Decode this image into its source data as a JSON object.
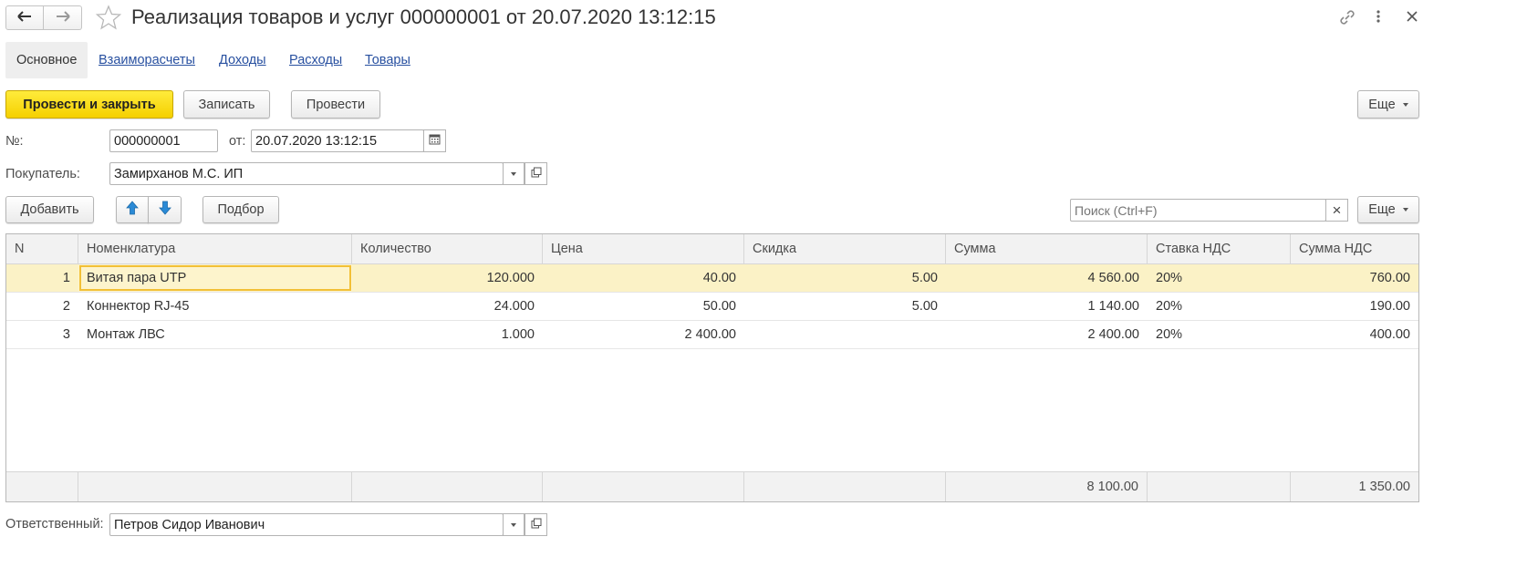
{
  "window": {
    "title": "Реализация товаров и услуг 000000001 от 20.07.2020 13:12:15",
    "back_glyph": "🡐",
    "forward_glyph": "🡒",
    "star_glyph": "☆",
    "link_glyph": "🔗",
    "more_glyph": "⋮",
    "close_glyph": "×"
  },
  "tabs": [
    {
      "label": "Основное",
      "active": true
    },
    {
      "label": "Взаиморасчеты"
    },
    {
      "label": "Доходы"
    },
    {
      "label": "Расходы"
    },
    {
      "label": "Товары"
    }
  ],
  "toolbar": {
    "post_close": "Провести и закрыть",
    "save": "Записать",
    "post": "Провести",
    "more": "Еще"
  },
  "form": {
    "number_label": "№:",
    "number_value": "000000001",
    "date_label": "от:",
    "date_value": "20.07.2020 13:12:15",
    "buyer_label": "Покупатель:",
    "buyer_value": "Замирханов М.С. ИП",
    "responsible_label": "Ответственный:",
    "responsible_value": "Петров Сидор Иванович"
  },
  "table_toolbar": {
    "add": "Добавить",
    "selection": "Подбор",
    "search_placeholder": "Поиск (Ctrl+F)",
    "clear_glyph": "×",
    "more": "Еще"
  },
  "table": {
    "columns": [
      "N",
      "Номенклатура",
      "Количество",
      "Цена",
      "Скидка",
      "Сумма",
      "Ставка НДС",
      "Сумма НДС"
    ],
    "rows": [
      [
        "1",
        "Витая пара UTP",
        "120.000",
        "40.00",
        "5.00",
        "4 560.00",
        "20%",
        "760.00"
      ],
      [
        "2",
        "Коннектор RJ-45",
        "24.000",
        "50.00",
        "5.00",
        "1 140.00",
        "20%",
        "190.00"
      ],
      [
        "3",
        "Монтаж ЛВС",
        "1.000",
        "2 400.00",
        "",
        "2 400.00",
        "20%",
        "400.00"
      ]
    ],
    "totals": [
      "",
      "",
      "",
      "",
      "",
      "8 100.00",
      "",
      "1 350.00"
    ]
  },
  "colors": {
    "accent_yellow": "#f5d000",
    "selected_row": "#fbf2c6",
    "link": "#2850a0",
    "arrow_blue": "#2a8ad6"
  }
}
